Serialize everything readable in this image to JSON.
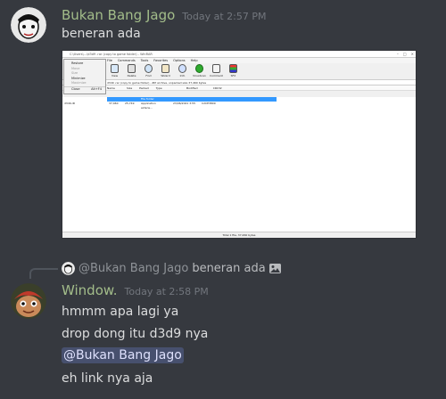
{
  "messages": [
    {
      "username": "Bukan Bang Jago",
      "username_color": "#a3bd8a",
      "timestamp": "Today at 2:57 PM",
      "lines": [
        "beneran ada"
      ],
      "attachment": {
        "titlebar": "C:\\Users\\...\\d3d9 .rar (copy to game folder) - WinRAR",
        "menus": [
          "File",
          "Commands",
          "Tools",
          "Favorites",
          "Options",
          "Help"
        ],
        "tools": [
          "Add",
          "Extract To",
          "Test",
          "View",
          "Delete",
          "Find",
          "Wizard",
          "Info",
          "VirusScan",
          "Comment",
          "SFX"
        ],
        "address": "d3d9 .rar (copy to game folder) - ZIP archive, unpacked size 37,460 bytes",
        "columns": [
          "Name",
          "Size",
          "Packed",
          "Type",
          "Modified",
          "CRC32"
        ],
        "folder_row": "File folder",
        "file_row": [
          "d3d9.dll",
          "37,460",
          "25,749",
          "Application extens...",
          "23/06/2021 3:55",
          "C2CE3809"
        ],
        "context_menu": [
          {
            "label": "Restore",
            "shortcut": "",
            "disabled": false
          },
          {
            "label": "Move",
            "shortcut": "",
            "disabled": true
          },
          {
            "label": "Size",
            "shortcut": "",
            "disabled": true
          },
          {
            "label": "Minimize",
            "shortcut": "",
            "disabled": false
          },
          {
            "label": "Maximize",
            "shortcut": "",
            "disabled": true
          },
          {
            "label": "Close",
            "shortcut": "Alt+F4",
            "disabled": false
          }
        ],
        "status": "Total 1 file, 37,460 bytes"
      }
    },
    {
      "reply": {
        "name": "@Bukan Bang Jago",
        "text": "beneran ada"
      },
      "username": "Window.",
      "username_color": "#a3bd8a",
      "timestamp": "Today at 2:58 PM",
      "lines": [
        "hmmm apa lagi ya",
        "drop dong itu d3d9 nya"
      ],
      "mention": "@Bukan Bang Jago",
      "last_line": "eh link nya aja"
    }
  ]
}
